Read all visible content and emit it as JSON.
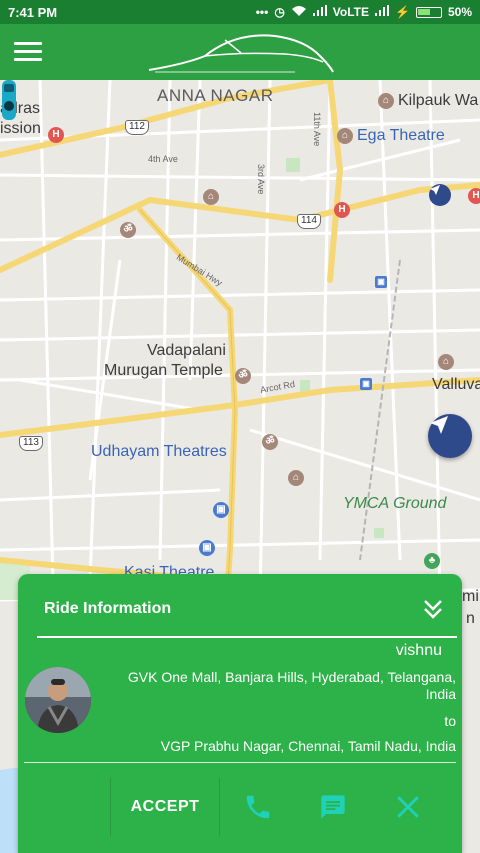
{
  "status_bar": {
    "time": "7:41 PM",
    "network": "VoLTE",
    "battery": "50%"
  },
  "app_bar": {
    "menu_icon": "hamburger-menu-icon",
    "logo_icon": "car-outline-logo"
  },
  "map": {
    "labels": {
      "anna_nagar": "ANNA NAGAR",
      "kilpauk": "Kilpauk Wa",
      "ega_theatre": "Ega Theatre",
      "madras": "adras",
      "mission": "ission",
      "fourth_ave": "4th Ave",
      "third_ave": "3rd Ave",
      "eleventh_ave": "11th Ave",
      "mumbai_hwy": "Mumbai Hwy",
      "vadapalani": "Vadapalani",
      "murugan_temple": "Murugan Temple",
      "arcot_rd": "Arcot Rd",
      "valluva": "Valluva",
      "udhayam": "Udhayam Theatres",
      "ymca": "YMCA Ground",
      "kasi_theatre": "Kasi Theatre",
      "edge_mi": "mi",
      "edge_n": "n"
    },
    "shields": {
      "r112": "112",
      "r114": "114",
      "r113": "113"
    },
    "colors": {
      "road_major": "#f6d776",
      "road_minor": "#ffffff",
      "park": "#c8e6c0"
    }
  },
  "ride_card": {
    "title": "Ride Information",
    "collapse_icon": "double-chevron-down-icon",
    "driver_name": "vishnu",
    "pickup": "GVK One Mall, Banjara Hills, Hyderabad, Telangana, India",
    "to_label": "to",
    "dropoff": "VGP Prabhu Nagar, Chennai, Tamil Nadu, India",
    "accept_label": "ACCEPT",
    "call_icon": "phone-icon",
    "message_icon": "message-icon",
    "reject_icon": "close-icon",
    "colors": {
      "card": "#2db24a",
      "icon_accent": "#22c55e",
      "reject": "#1fc2b8"
    }
  }
}
